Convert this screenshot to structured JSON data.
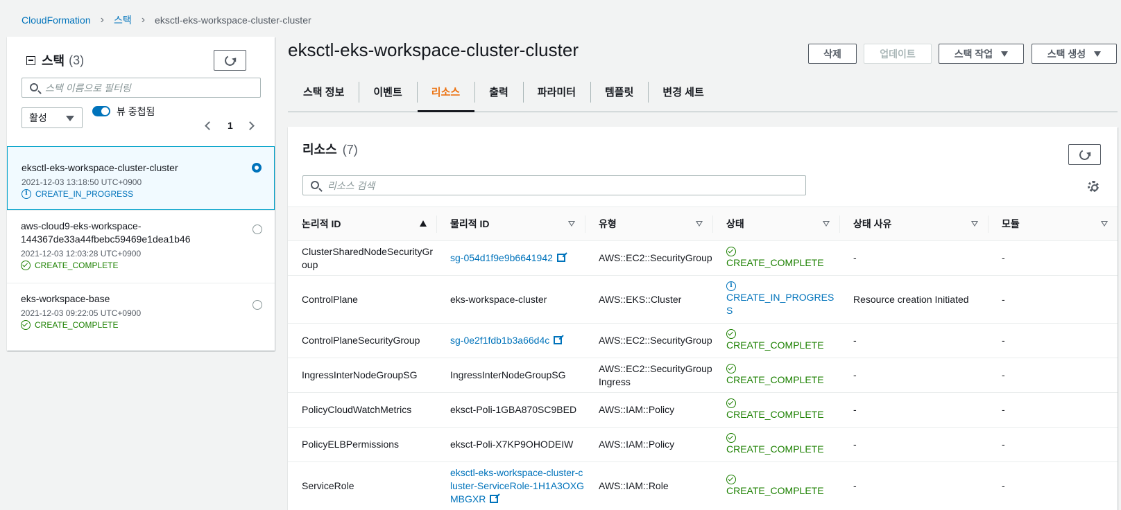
{
  "breadcrumb": {
    "root": "CloudFormation",
    "stacks": "스택",
    "current": "eksctl-eks-workspace-cluster-cluster"
  },
  "sidebar": {
    "title": "스택",
    "count": "(3)",
    "filter_placeholder": "스택 이름으로 필터링",
    "status_filter": "활성",
    "nested_toggle_label": "뷰 중첩됨",
    "page": "1",
    "stacks": [
      {
        "name": "eksctl-eks-workspace-cluster-cluster",
        "time": "2021-12-03 13:18:50 UTC+0900",
        "status": "CREATE_IN_PROGRESS"
      },
      {
        "name": "aws-cloud9-eks-workspace-144367de33a44fbebc59469e1dea1b46",
        "time": "2021-12-03 12:03:28 UTC+0900",
        "status": "CREATE_COMPLETE"
      },
      {
        "name": "eks-workspace-base",
        "time": "2021-12-03 09:22:05 UTC+0900",
        "status": "CREATE_COMPLETE"
      }
    ]
  },
  "header": {
    "title": "eksctl-eks-workspace-cluster-cluster",
    "delete": "삭제",
    "update": "업데이트",
    "stack_actions": "스택 작업",
    "create_stack": "스택 생성"
  },
  "tabs": [
    "스택 정보",
    "이벤트",
    "리소스",
    "출력",
    "파라미터",
    "템플릿",
    "변경 세트"
  ],
  "resources": {
    "title": "리소스",
    "count": "(7)",
    "search_placeholder": "리소스 검색",
    "columns": [
      "논리적 ID",
      "물리적 ID",
      "유형",
      "상태",
      "상태 사유",
      "모듈"
    ],
    "rows": [
      {
        "logical": "ClusterSharedNodeSecurityGroup",
        "physical": "sg-054d1f9e9b6641942",
        "type": "AWS::EC2::SecurityGroup",
        "status": "CREATE_COMPLETE",
        "reason": "-",
        "module": "-"
      },
      {
        "logical": "ControlPlane",
        "physical": "eks-workspace-cluster",
        "type": "AWS::EKS::Cluster",
        "status": "CREATE_IN_PROGRESS",
        "reason": "Resource creation Initiated",
        "module": "-"
      },
      {
        "logical": "ControlPlaneSecurityGroup",
        "physical": "sg-0e2f1fdb1b3a66d4c",
        "type": "AWS::EC2::SecurityGroup",
        "status": "CREATE_COMPLETE",
        "reason": "-",
        "module": "-"
      },
      {
        "logical": "IngressInterNodeGroupSG",
        "physical": "IngressInterNodeGroupSG",
        "type": "AWS::EC2::SecurityGroupIngress",
        "status": "CREATE_COMPLETE",
        "reason": "-",
        "module": "-"
      },
      {
        "logical": "PolicyCloudWatchMetrics",
        "physical": "eksct-Poli-1GBA870SC9BED",
        "type": "AWS::IAM::Policy",
        "status": "CREATE_COMPLETE",
        "reason": "-",
        "module": "-"
      },
      {
        "logical": "PolicyELBPermissions",
        "physical": "eksct-Poli-X7KP9OHODEIW",
        "type": "AWS::IAM::Policy",
        "status": "CREATE_COMPLETE",
        "reason": "-",
        "module": "-"
      },
      {
        "logical": "ServiceRole",
        "physical": "eksctl-eks-workspace-cluster-cluster-ServiceRole-1H1A3OXGMBGXR",
        "type": "AWS::IAM::Role",
        "status": "CREATE_COMPLETE",
        "reason": "-",
        "module": "-"
      }
    ]
  },
  "colors": {
    "link": "#0073bb",
    "success": "#1d8102",
    "accent": "#ec7211"
  }
}
